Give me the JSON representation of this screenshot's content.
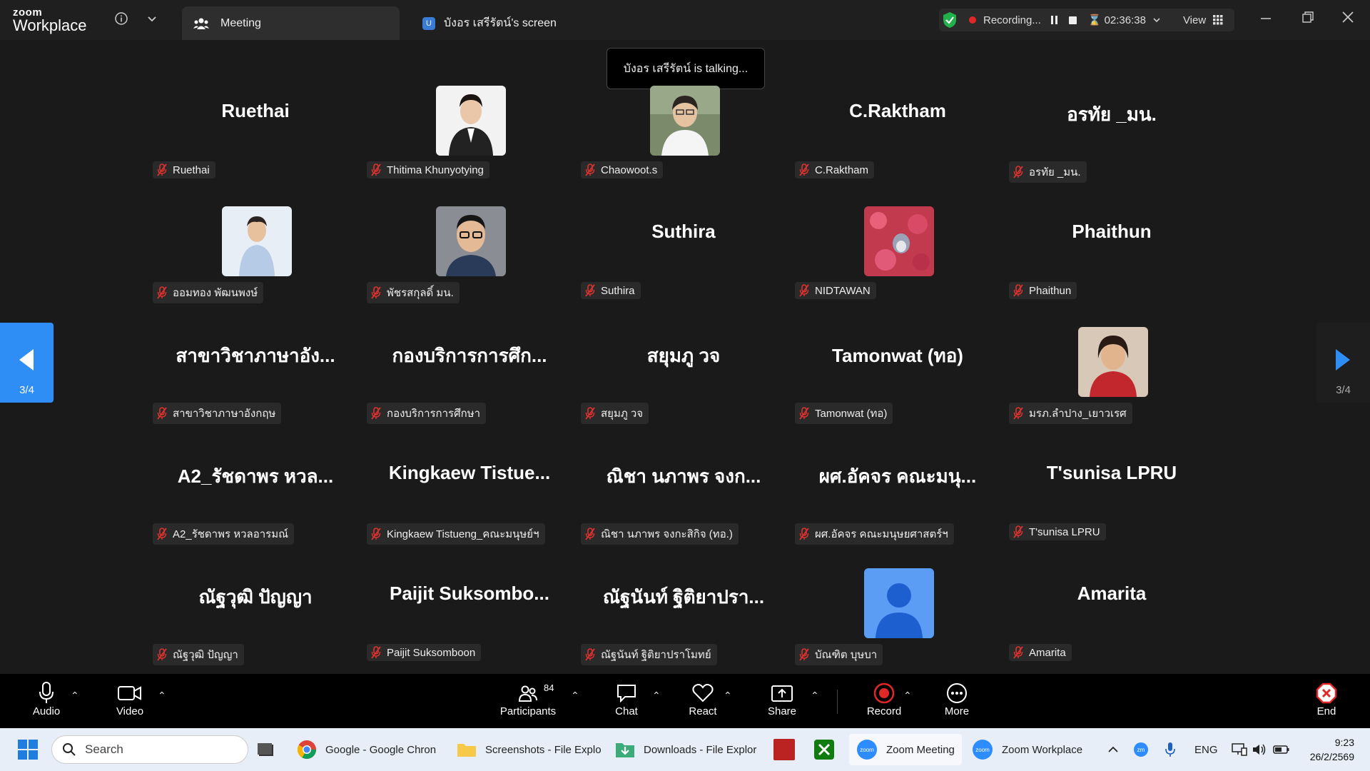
{
  "app": {
    "brand_small": "zoom",
    "brand_large": "Workplace"
  },
  "tabs": [
    {
      "label": "Meeting"
    },
    {
      "label": "บังอร  เสรีรัตน์'s screen",
      "badge": "U"
    }
  ],
  "recording": {
    "status": "Recording...",
    "timer": "02:36:38",
    "view_label": "View"
  },
  "toast": "บังอร  เสรีรัตน์ is talking...",
  "pager": {
    "left": "3/4",
    "right": "3/4"
  },
  "participants": [
    {
      "display": "Ruethai",
      "label": "Ruethai",
      "avatar": null
    },
    {
      "display": "",
      "label": "Thitima Khunyotying",
      "avatar": "photo-woman-suit"
    },
    {
      "display": "",
      "label": "Chaowoot.s",
      "avatar": "photo-man-outdoor"
    },
    {
      "display": "C.Raktham",
      "label": "C.Raktham",
      "avatar": null
    },
    {
      "display": "อรทัย _มน.",
      "label": "อรทัย _มน.",
      "avatar": null
    },
    {
      "display": "",
      "label": "ออมทอง พัฒนพงษ์",
      "avatar": "photo-woman-shirt"
    },
    {
      "display": "",
      "label": "พัชรสกุลดิ์ มน.",
      "avatar": "photo-man-glasses"
    },
    {
      "display": "Suthira",
      "label": "Suthira",
      "avatar": null
    },
    {
      "display": "",
      "label": "NIDTAWAN",
      "avatar": "photo-flowers"
    },
    {
      "display": "Phaithun",
      "label": "Phaithun",
      "avatar": null
    },
    {
      "display": "สาขาวิชาภาษาอัง...",
      "label": "สาขาวิชาภาษาอังกฤษ",
      "avatar": null
    },
    {
      "display": "กองบริการการศึก...",
      "label": "กองบริการการศึกษา",
      "avatar": null
    },
    {
      "display": "สยุมภู  วจ",
      "label": "สยุมภู  วจ",
      "avatar": null
    },
    {
      "display": "Tamonwat (ทอ)",
      "label": "Tamonwat (ทอ)",
      "avatar": null
    },
    {
      "display": "",
      "label": "มรภ.ลำปาง_เยาวเรศ",
      "avatar": "photo-woman-red"
    },
    {
      "display": "A2_รัชดาพร หวล...",
      "label": "A2_รัชดาพร หวลอารมณ์",
      "avatar": null
    },
    {
      "display": "Kingkaew  Tistue...",
      "label": "Kingkaew Tistueng_คณะมนุษย์ฯ",
      "avatar": null
    },
    {
      "display": "ณิชา นภาพร จงก...",
      "label": "ณิชา นภาพร จงกะสิกิจ (ทอ.)",
      "avatar": null
    },
    {
      "display": "ผศ.อัคจร คณะมนุ...",
      "label": "ผศ.อัคจร คณะมนุษยศาสตร์ฯ",
      "avatar": null
    },
    {
      "display": "T'sunisa LPRU",
      "label": "T'sunisa LPRU",
      "avatar": null
    },
    {
      "display": "ณัฐวุฒิ ปัญญา",
      "label": "ณัฐวุฒิ ปัญญา",
      "avatar": null
    },
    {
      "display": "Paijit  Suksombo...",
      "label": "Paijit Suksomboon",
      "avatar": null
    },
    {
      "display": "ณัฐนันท์ ฐิติยาปรา...",
      "label": "ณัฐนันท์ ฐิติยาปราโมทย์",
      "avatar": null
    },
    {
      "display": "",
      "label": "บัณฑิต บุษบา",
      "avatar": "default-person"
    },
    {
      "display": "Amarita",
      "label": "Amarita",
      "avatar": null
    }
  ],
  "toolbar": {
    "audio": "Audio",
    "video": "Video",
    "participants": "Participants",
    "participants_count": "84",
    "chat": "Chat",
    "react": "React",
    "share": "Share",
    "record": "Record",
    "more": "More",
    "end": "End"
  },
  "taskbar": {
    "search": "Search",
    "apps": [
      {
        "label": "Google - Google Chron",
        "icon": "chrome-icon"
      },
      {
        "label": "Screenshots - File Explo",
        "icon": "folder-icon"
      },
      {
        "label": "Downloads - File Explor",
        "icon": "downloads-icon"
      },
      {
        "label": "Zoom Meeting",
        "icon": "zoom-icon"
      },
      {
        "label": "Zoom Workplace",
        "icon": "zoom-icon"
      }
    ],
    "lang": "ENG",
    "time": "9:23",
    "date": "26/2/2569"
  },
  "colors": {
    "accent": "#2e8ef5",
    "record_red": "#e02828",
    "mute_red": "#e0322e",
    "shield_green": "#22b14c"
  }
}
